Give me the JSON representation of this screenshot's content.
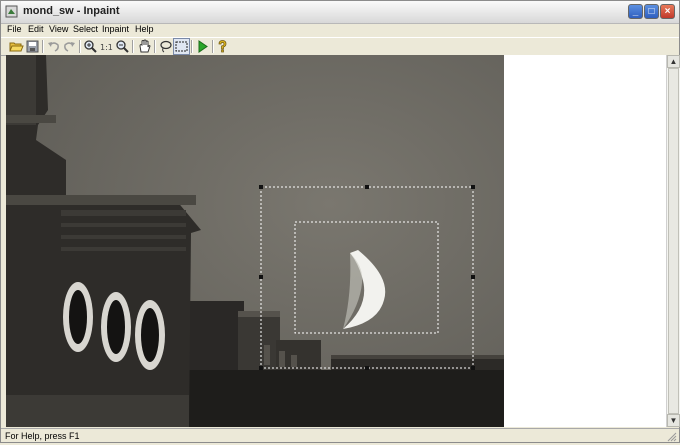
{
  "window": {
    "title": "mond_sw - Inpaint",
    "icon": "inpaint-app-icon",
    "controls": [
      "minimize",
      "maximize",
      "close"
    ]
  },
  "menu": {
    "items": [
      "File",
      "Edit",
      "View",
      "Select",
      "Inpaint",
      "Help"
    ]
  },
  "toolbar": {
    "buttons": [
      "open-folder-icon",
      "save-icon",
      "undo-icon",
      "redo-icon",
      "zoom-in-icon",
      "actual-size-icon",
      "zoom-out-icon",
      "hand-pan-icon",
      "lasso-select-icon",
      "rect-select-icon",
      "run-inpaint-icon",
      "help-icon"
    ],
    "actual_size_label": "1:1"
  },
  "status": {
    "text": "For Help, press F1"
  },
  "colors": {
    "sky": "#74716a",
    "selection_dash": "#ffffff",
    "run_green": "#2aa62a"
  }
}
